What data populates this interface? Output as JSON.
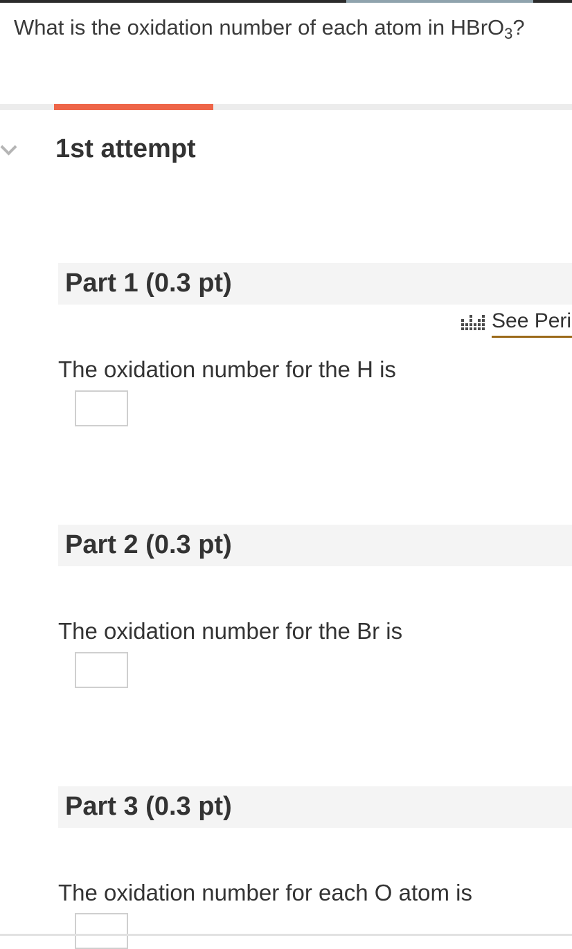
{
  "question": {
    "text_before": "What is the oxidation number of each atom in HBrO",
    "subscript": "3",
    "text_after": "?"
  },
  "attempt": {
    "label": "1st attempt"
  },
  "periodic_table_link": {
    "label": "See Periodic Table",
    "icon": "periodic-table-icon"
  },
  "parts": [
    {
      "title": "Part 1 (0.3 pt)",
      "prompt": "The oxidation number for the H is",
      "answer_value": ""
    },
    {
      "title": "Part 2 (0.3 pt)",
      "prompt": "The oxidation number for the Br is",
      "answer_value": ""
    },
    {
      "title": "Part 3 (0.3 pt)",
      "prompt": "The oxidation number for each O atom is",
      "answer_value": ""
    }
  ],
  "colors": {
    "progress_accent": "#ee6548",
    "link_underline": "#9b6a1a",
    "header_background": "#f4f4f4"
  }
}
